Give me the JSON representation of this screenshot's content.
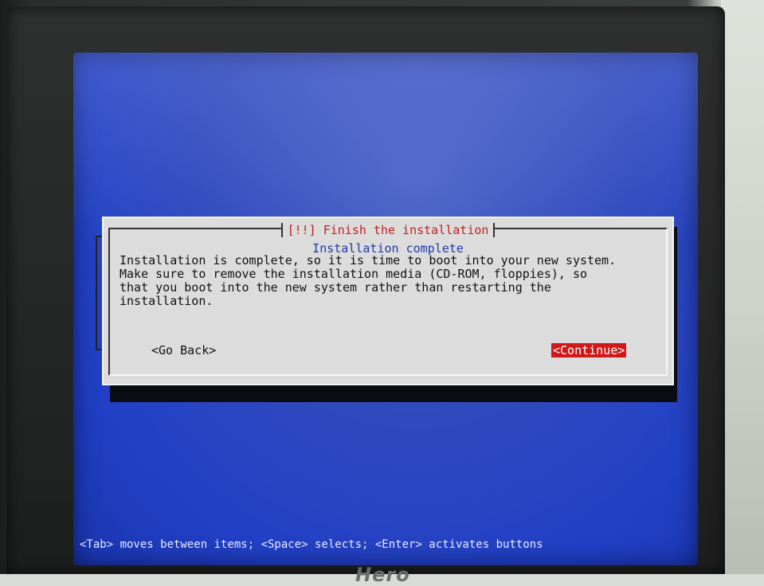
{
  "dialog": {
    "title": "[!!] Finish the installation",
    "subtitle": "Installation complete",
    "body": "Installation is complete, so it is time to boot into your new system.\nMake sure to remove the installation media (CD-ROM, floppies), so\nthat you boot into the new system rather than restarting the\ninstallation.",
    "buttons": {
      "go_back": "<Go Back>",
      "continue": "<Continue>"
    }
  },
  "status_bar": {
    "hint": "<Tab> moves between items; <Space> selects; <Enter> activates buttons"
  },
  "monitor": {
    "brand": "Hero"
  },
  "colors": {
    "screen_blue": "#2140c6",
    "dialog_gray": "#dcdcdc",
    "title_red": "#c42020",
    "subtitle_blue": "#1b3aa8",
    "selected_button": "#d01818"
  }
}
